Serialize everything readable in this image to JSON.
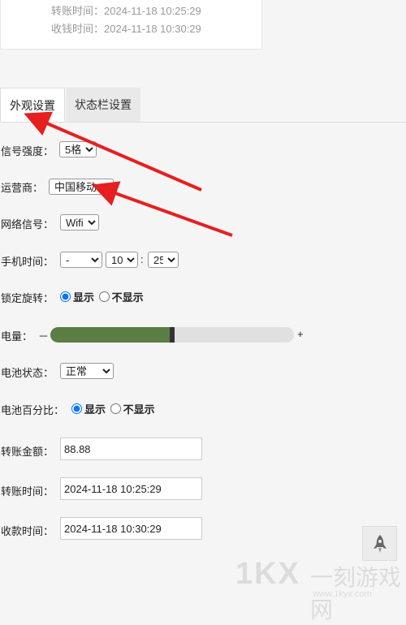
{
  "preview": {
    "transfer_time_label": "转账时间：",
    "transfer_time_value": "2024-11-18 10:25:29",
    "receive_time_label": "收钱时间：",
    "receive_time_value": "2024-11-18 10:30:29"
  },
  "tabs": [
    {
      "label": "外观设置",
      "active": true
    },
    {
      "label": "状态栏设置",
      "active": false
    }
  ],
  "form": {
    "signal_strength": {
      "label": "信号强度：",
      "value": "5格"
    },
    "carrier": {
      "label": "运营商：",
      "value": "中国移动"
    },
    "network_signal": {
      "label": "网络信号：",
      "value": "Wifi"
    },
    "phone_time": {
      "label": "手机时间：",
      "ampm": "-",
      "hour": "10",
      "separator": ":",
      "minute": "25"
    },
    "lock_rotation": {
      "label": "锁定旋转：",
      "option_show": "显示",
      "option_hide": "不显示",
      "selected": "显示"
    },
    "battery_level": {
      "label": "电量：",
      "minus": "－",
      "plus": "+",
      "level_percent": 50
    },
    "battery_status": {
      "label": "电池状态：",
      "value": "正常"
    },
    "battery_percent": {
      "label": "电池百分比：",
      "option_show": "显示",
      "option_hide": "不显示",
      "selected": "显示"
    },
    "transfer_amount": {
      "label": "转账金额：",
      "value": "88.88"
    },
    "transfer_time": {
      "label": "转账时间：",
      "value": "2024-11-18 10:25:29"
    },
    "receive_time": {
      "label": "收款时间：",
      "value": "2024-11-18 10:30:29"
    }
  },
  "icons": {
    "back_to_top": "rocket-icon"
  },
  "watermark": {
    "logo": "1KX",
    "name": "一刻游戏网",
    "url": "www.1kyx.com"
  },
  "colors": {
    "battery_fill": "#5c7d43",
    "arrow": "#e52020",
    "radio_accent": "#1a73e8"
  }
}
